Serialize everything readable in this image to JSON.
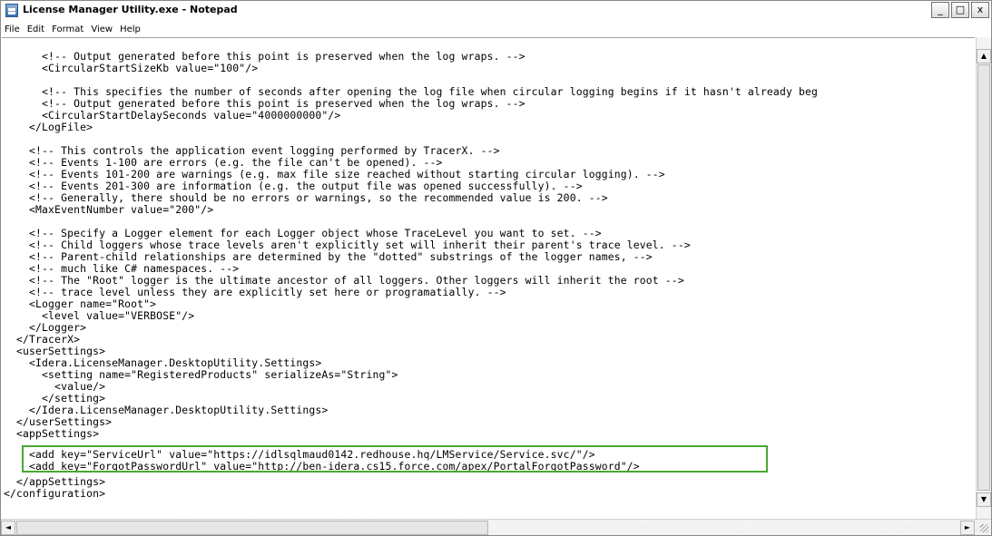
{
  "window": {
    "title": "License Manager Utility.exe - Notepad",
    "controls": {
      "minimize": "_",
      "maximize": "□",
      "close": "x"
    }
  },
  "menu": {
    "items": [
      "File",
      "Edit",
      "Format",
      "View",
      "Help"
    ]
  },
  "editor": {
    "lines": [
      "      <!-- Output generated before this point is preserved when the log wraps. -->",
      "      <CircularStartSizeKb value=\"100\"/>",
      "",
      "      <!-- This specifies the number of seconds after opening the log file when circular logging begins if it hasn't already beg",
      "      <!-- Output generated before this point is preserved when the log wraps. -->",
      "      <CircularStartDelaySeconds value=\"4000000000\"/>",
      "    </LogFile>",
      "",
      "    <!-- This controls the application event logging performed by TracerX. -->",
      "    <!-- Events 1-100 are errors (e.g. the file can't be opened). -->",
      "    <!-- Events 101-200 are warnings (e.g. max file size reached without starting circular logging). -->",
      "    <!-- Events 201-300 are information (e.g. the output file was opened successfully). -->",
      "    <!-- Generally, there should be no errors or warnings, so the recommended value is 200. -->",
      "    <MaxEventNumber value=\"200\"/>",
      "",
      "    <!-- Specify a Logger element for each Logger object whose TraceLevel you want to set. -->",
      "    <!-- Child loggers whose trace levels aren't explicitly set will inherit their parent's trace level. -->",
      "    <!-- Parent-child relationships are determined by the \"dotted\" substrings of the logger names, -->",
      "    <!-- much like C# namespaces. -->",
      "    <!-- The \"Root\" logger is the ultimate ancestor of all loggers. Other loggers will inherit the root -->",
      "    <!-- trace level unless they are explicitly set here or programatially. -->",
      "    <Logger name=\"Root\">",
      "      <level value=\"VERBOSE\"/>",
      "    </Logger>",
      "  </TracerX>",
      "  <userSettings>",
      "    <Idera.LicenseManager.DesktopUtility.Settings>",
      "      <setting name=\"RegisteredProducts\" serializeAs=\"String\">",
      "        <value/>",
      "      </setting>",
      "    </Idera.LicenseManager.DesktopUtility.Settings>",
      "  </userSettings>",
      "  <appSettings>",
      "    <add key=\"ServiceUrl\" value=\"https://idlsqlmaud0142.redhouse.hq/LMService/Service.svc/\"/>",
      "    <add key=\"ForgotPasswordUrl\" value=\"http://ben-idera.cs15.force.com/apex/PortalForgotPassword\"/>",
      "  </appSettings>",
      "</configuration>"
    ]
  },
  "scrollbar": {
    "up": "▲",
    "down": "▼",
    "left": "◄",
    "right": "►"
  },
  "colors": {
    "highlight": "#49a832"
  }
}
